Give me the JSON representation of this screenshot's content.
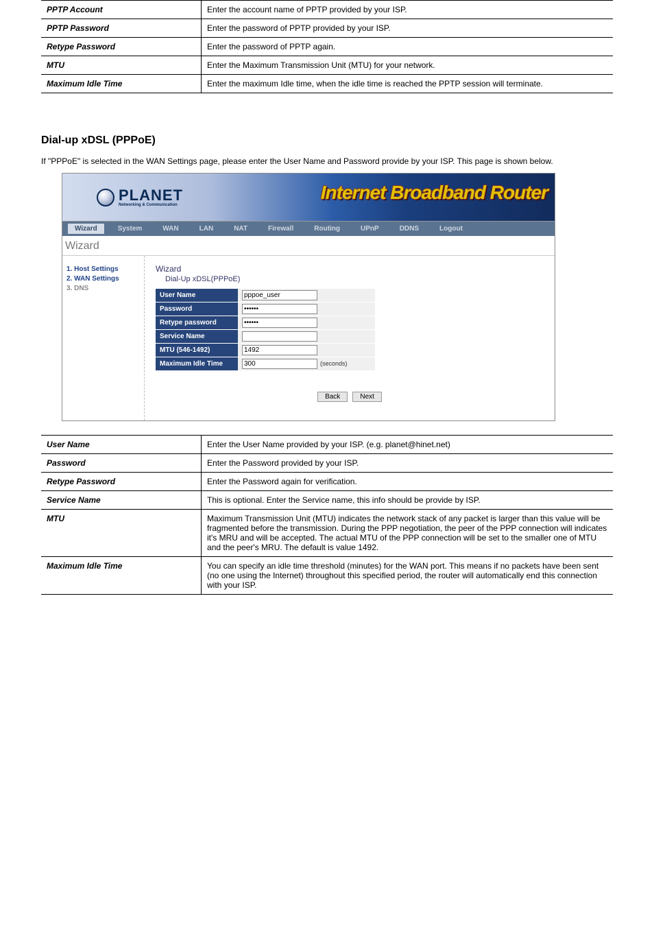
{
  "table1": {
    "rows": [
      {
        "label": "PPTP Account",
        "value": "Enter the account name of PPTP provided by your ISP."
      },
      {
        "label": "PPTP Password",
        "value": "Enter the password of PPTP provided by your ISP."
      },
      {
        "label": "Retype Password",
        "value": "Enter the password of PPTP again."
      },
      {
        "label": "MTU",
        "value": "Enter the Maximum Transmission Unit (MTU) for your network."
      },
      {
        "label": "Maximum Idle Time",
        "value": "Enter the maximum Idle time, when the idle time is reached the PPTP session will terminate."
      }
    ]
  },
  "heading1": "Dial-up xDSL (PPPoE)",
  "para1": "If \"PPPoE\" is selected in the WAN Settings page, please enter the User Name and Password provide by your ISP. This page is shown below.",
  "router": {
    "logo_text": "PLANET",
    "logo_sub": "Networking & Communication",
    "banner_title": "Internet Broadband Router",
    "nav": [
      "Wizard",
      "System",
      "WAN",
      "LAN",
      "NAT",
      "Firewall",
      "Routing",
      "UPnP",
      "DDNS",
      "Logout"
    ],
    "nav_active_index": 0,
    "crumb": "Wizard",
    "side_steps": [
      {
        "text": "1. Host Settings",
        "dim": false
      },
      {
        "text": "2. WAN Settings",
        "dim": false
      },
      {
        "text": "3. DNS",
        "dim": true
      }
    ],
    "main_title": "Wizard",
    "main_sub": "Dial-Up xDSL(PPPoE)",
    "fields": [
      {
        "label": "User Name",
        "type": "text",
        "value": "pppoe_user",
        "suffix": ""
      },
      {
        "label": "Password",
        "type": "password",
        "value": "••••••",
        "suffix": ""
      },
      {
        "label": "Retype password",
        "type": "password",
        "value": "••••••",
        "suffix": ""
      },
      {
        "label": "Service Name",
        "type": "text",
        "value": "",
        "suffix": ""
      },
      {
        "label": "MTU (546-1492)",
        "type": "text",
        "value": "1492",
        "suffix": ""
      },
      {
        "label": "Maximum Idle Time",
        "type": "text",
        "value": "300",
        "suffix": "(seconds)"
      }
    ],
    "buttons": {
      "back": "Back",
      "next": "Next"
    }
  },
  "table2": {
    "rows": [
      {
        "label": "User Name",
        "value": "Enter the User Name provided by your ISP. (e.g. planet@hinet.net)"
      },
      {
        "label": "Password",
        "value": "Enter the Password provided by your ISP."
      },
      {
        "label": "Retype Password",
        "value": "Enter the Password again for verification."
      },
      {
        "label": "Service Name",
        "value": "This is optional. Enter the Service name, this info should be provide by ISP."
      },
      {
        "label": "MTU",
        "value": "Maximum Transmission Unit (MTU) indicates the network stack of any packet is larger than this value will be fragmented before the transmission. During the PPP negotiation, the peer of the PPP connection will indicates it's MRU and will be accepted. The actual MTU of the PPP connection will be set to the smaller one of MTU and the peer's MRU. The default is value 1492."
      },
      {
        "label": "Maximum Idle Time",
        "value": "You can specify an idle time threshold (minutes) for the WAN port. This means if no packets have been sent (no one using the Internet) throughout this specified period, the router will automatically end this connection with your ISP."
      }
    ]
  }
}
